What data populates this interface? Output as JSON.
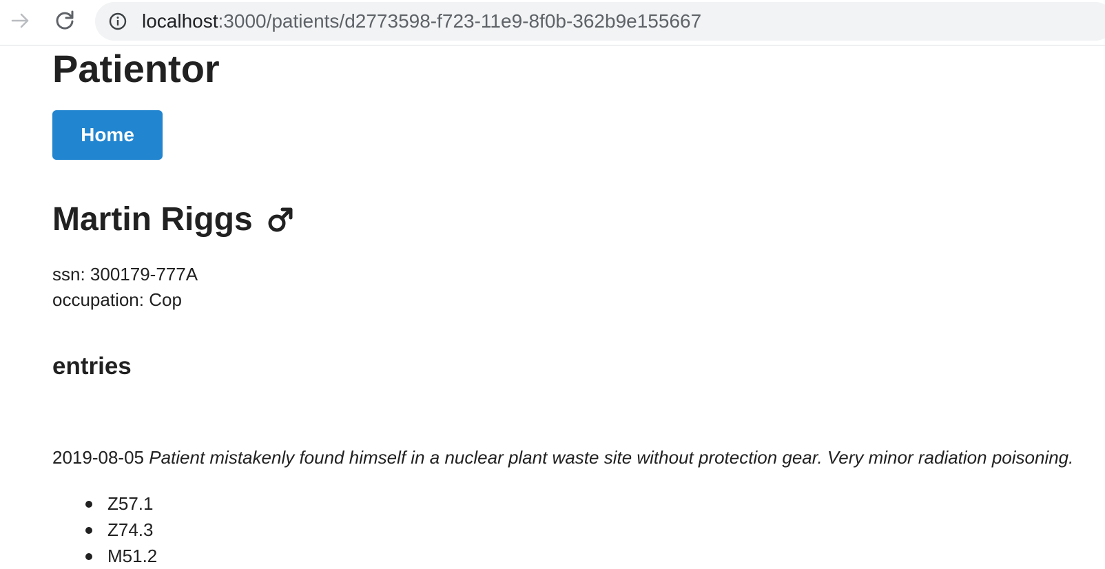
{
  "browser": {
    "url_host": "localhost",
    "url_path": ":3000/patients/d2773598-f723-11e9-8f0b-362b9e155667",
    "forward_icon": "arrow-right-icon",
    "reload_icon": "reload-icon",
    "site_info_icon": "info-icon"
  },
  "app": {
    "title": "Patientor",
    "home_button": "Home",
    "accent_color": "#2185d0"
  },
  "patient": {
    "name": "Martin Riggs",
    "gender_icon": "male-gender-icon",
    "ssn_label": "ssn: 300179-777A",
    "occupation_label": "occupation: Cop"
  },
  "entries": {
    "heading": "entries",
    "items": [
      {
        "date": "2019-08-05",
        "description": "Patient mistakenly found himself in a nuclear plant waste site without protection gear. Very minor radiation poisoning.",
        "codes": [
          "Z57.1",
          "Z74.3",
          "M51.2"
        ]
      }
    ]
  }
}
